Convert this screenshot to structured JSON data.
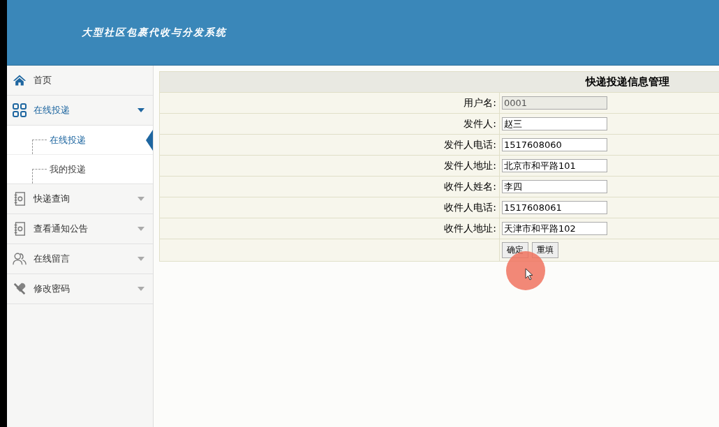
{
  "header": {
    "title": "大型社区包裹代收与分发系统"
  },
  "sidebar": {
    "items": [
      {
        "label": "首页",
        "kind": "home"
      },
      {
        "label": "在线投递",
        "kind": "grid",
        "expanded": true,
        "children": [
          {
            "label": "在线投递",
            "selected": true
          },
          {
            "label": "我的投递",
            "selected": false
          }
        ]
      },
      {
        "label": "快递查询",
        "kind": "notebook",
        "expanded": false
      },
      {
        "label": "查看通知公告",
        "kind": "notebook",
        "expanded": false
      },
      {
        "label": "在线留言",
        "kind": "people",
        "expanded": false
      },
      {
        "label": "修改密码",
        "kind": "tools",
        "expanded": false
      }
    ]
  },
  "form": {
    "title": "快递投递信息管理",
    "fields": [
      {
        "label": "用户名:",
        "value": "0001",
        "disabled": true
      },
      {
        "label": "发件人:",
        "value": "赵三",
        "disabled": false
      },
      {
        "label": "发件人电话:",
        "value": "1517608060",
        "disabled": false
      },
      {
        "label": "发件人地址:",
        "value": "北京市和平路101",
        "disabled": false
      },
      {
        "label": "收件人姓名:",
        "value": "李四",
        "disabled": false
      },
      {
        "label": "收件人电话:",
        "value": "1517608061",
        "disabled": false
      },
      {
        "label": "收件人地址:",
        "value": "天津市和平路102",
        "disabled": false
      }
    ],
    "buttons": [
      "确定",
      "重填"
    ]
  }
}
